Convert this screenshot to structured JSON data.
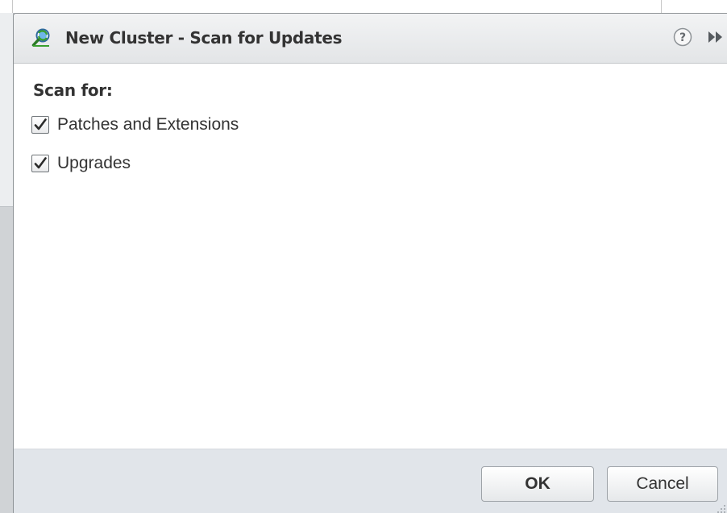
{
  "dialog": {
    "title": "New Cluster - Scan for Updates",
    "title_icon": "scan-cluster-icon",
    "help_icon": "help-icon",
    "expand_icon": "fast-forward-icon"
  },
  "content": {
    "section_label": "Scan for:",
    "options": [
      {
        "label": "Patches and Extensions",
        "checked": true
      },
      {
        "label": "Upgrades",
        "checked": true
      }
    ]
  },
  "footer": {
    "ok_label": "OK",
    "cancel_label": "Cancel"
  },
  "colors": {
    "titlebar": "#e6e8ea",
    "footer": "#e1e5ea",
    "icon_green": "#3aa02f",
    "icon_blue": "#2a6fc0"
  }
}
